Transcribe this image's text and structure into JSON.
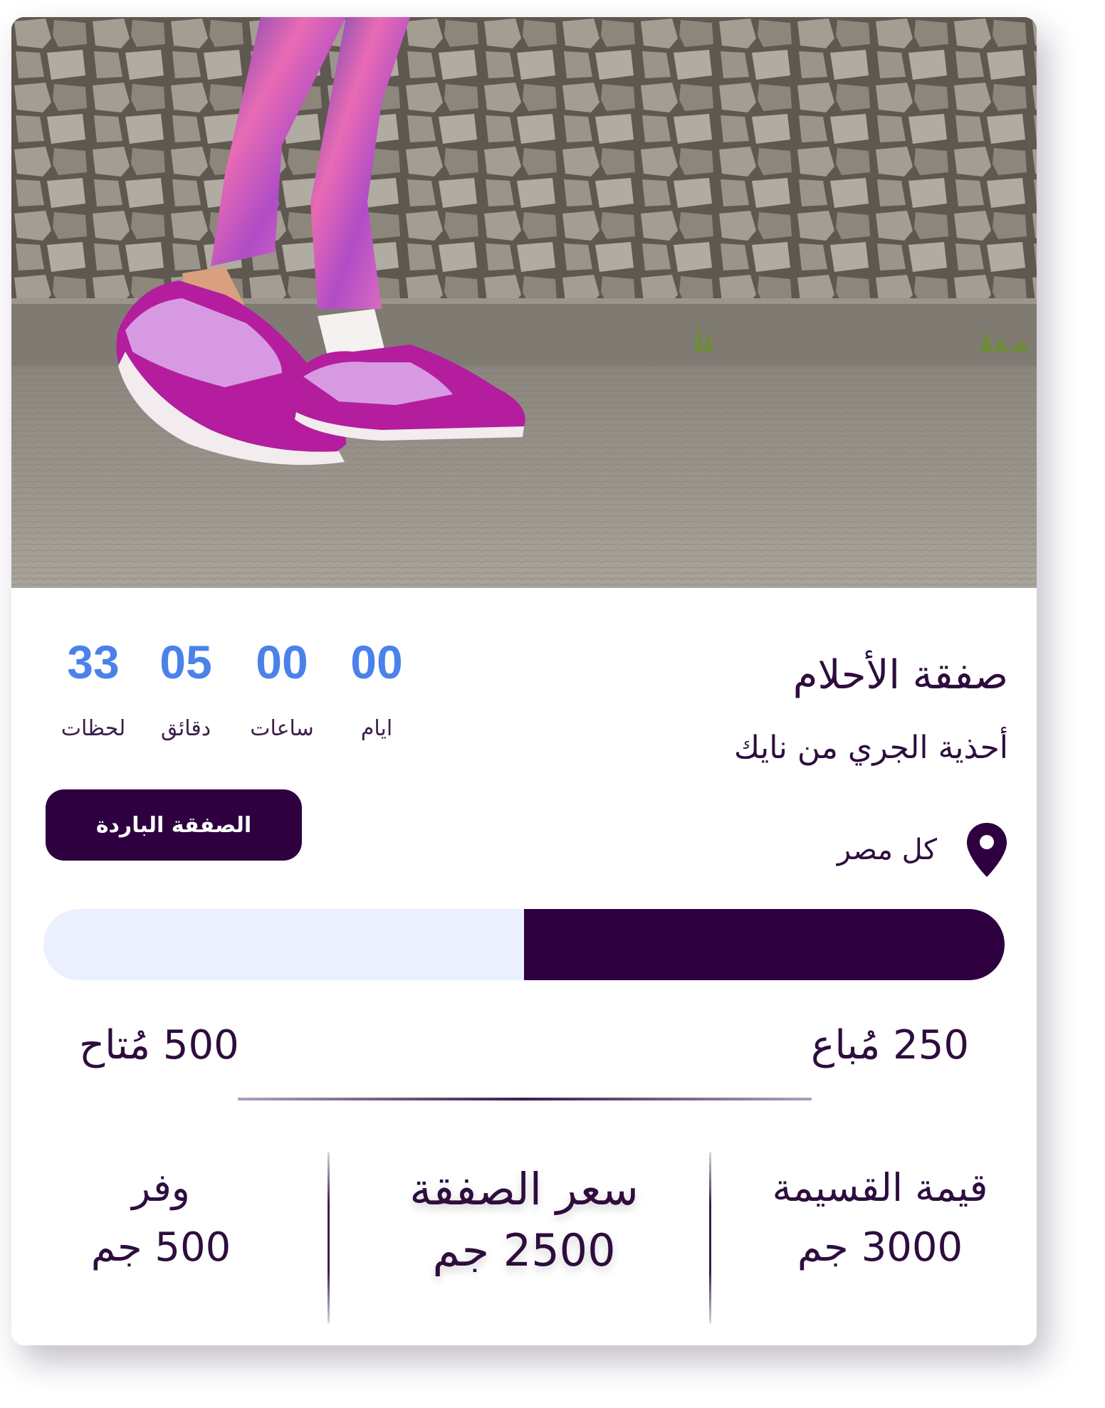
{
  "hero": {
    "image": "running-shoes-photo"
  },
  "countdown": [
    {
      "value": "33",
      "label": "لحظات"
    },
    {
      "value": "05",
      "label": "دقائق"
    },
    {
      "value": "00",
      "label": "ساعات"
    },
    {
      "value": "00",
      "label": "ايام"
    }
  ],
  "deal": {
    "title": "صفقة الأحلام",
    "subtitle": "أحذية الجري من نايك",
    "location": "كل مصر",
    "location_icon": "map-pin-icon",
    "cold_deal_button": "الصفقة الباردة"
  },
  "progress": {
    "sold_fraction": 0.5,
    "sold_label": "250 مُباع",
    "available_label": "500 مُتاح"
  },
  "stats": {
    "voucher_value_label": "قيمة القسيمة",
    "voucher_value": "3000 جم",
    "deal_price_label": "سعر الصفقة",
    "deal_price": "2500 جم",
    "savings_label": "وفر",
    "savings": "500 جم"
  },
  "colors": {
    "accent_blue": "#4a82ea",
    "brand_purple": "#2e0040",
    "text_purple": "#2e0d3e",
    "progress_track": "#eaf0fd"
  }
}
